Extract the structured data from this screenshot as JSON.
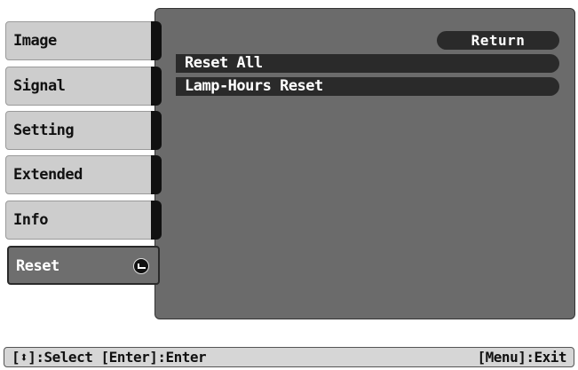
{
  "menu": {
    "items": [
      {
        "label": "Image"
      },
      {
        "label": "Signal"
      },
      {
        "label": "Setting"
      },
      {
        "label": "Extended"
      },
      {
        "label": "Info"
      },
      {
        "label": "Reset",
        "selected": true
      }
    ]
  },
  "panel": {
    "return_label": "Return",
    "options": [
      {
        "label": "Reset All"
      },
      {
        "label": "Lamp-Hours Reset"
      }
    ]
  },
  "status_bar": {
    "left_hint": "[⬍]:Select [Enter]:Enter",
    "right_hint": "[Menu]:Exit"
  },
  "colors": {
    "panel_bg": "#6b6b6b",
    "item_bg": "#2a2a2a",
    "menu_bg": "#cdcdcd",
    "selected_bg": "#6e6e6e"
  },
  "icons": {
    "selected_item_icon": "enter-icon",
    "select_hint_icon": "up-down-arrow-icon"
  }
}
